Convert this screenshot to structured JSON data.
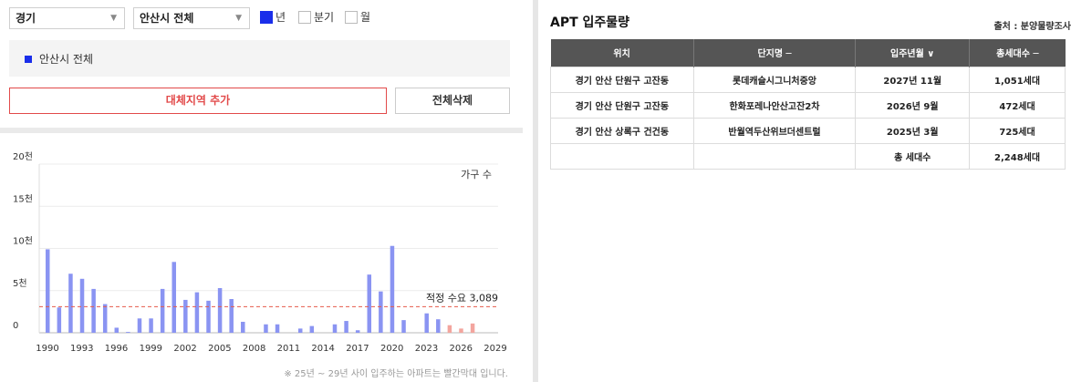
{
  "filters": {
    "province": "경기",
    "city": "안산시 전체",
    "periods": [
      {
        "label": "년",
        "checked": true
      },
      {
        "label": "분기",
        "checked": false
      },
      {
        "label": "월",
        "checked": false
      }
    ]
  },
  "region_tag": "안산시 전체",
  "buttons": {
    "add": "대체지역 추가",
    "clear": "전체삭제"
  },
  "note": "※ 25년 ~ 29년 사이 입주하는 아파트는 빨간막대 입니다.",
  "chart_data": {
    "type": "bar",
    "legend": "가구 수",
    "y_ticks": [
      "0",
      "5천",
      "10천",
      "15천",
      "20천"
    ],
    "ylim": [
      0,
      20000
    ],
    "x_ticks": [
      "1990",
      "1993",
      "1996",
      "1999",
      "2002",
      "2005",
      "2008",
      "2011",
      "2014",
      "2017",
      "2020",
      "2023",
      "2026",
      "2029"
    ],
    "x_range": [
      1990,
      2029
    ],
    "reference_line": {
      "label": "적정 수요 3,089",
      "value": 3089
    },
    "colors": {
      "past": "#8a94f2",
      "future": "#f3a59e",
      "ref": "#e65a4a"
    },
    "bars": [
      {
        "year": 1990,
        "value": 9900
      },
      {
        "year": 1991,
        "value": 3000
      },
      {
        "year": 1992,
        "value": 7000
      },
      {
        "year": 1993,
        "value": 6400
      },
      {
        "year": 1994,
        "value": 5200
      },
      {
        "year": 1995,
        "value": 3400
      },
      {
        "year": 1996,
        "value": 600
      },
      {
        "year": 1997,
        "value": 100
      },
      {
        "year": 1998,
        "value": 1700
      },
      {
        "year": 1999,
        "value": 1700
      },
      {
        "year": 2000,
        "value": 5200
      },
      {
        "year": 2001,
        "value": 8400
      },
      {
        "year": 2002,
        "value": 3900
      },
      {
        "year": 2003,
        "value": 4800
      },
      {
        "year": 2004,
        "value": 3800
      },
      {
        "year": 2005,
        "value": 5300
      },
      {
        "year": 2006,
        "value": 4000
      },
      {
        "year": 2007,
        "value": 1300
      },
      {
        "year": 2009,
        "value": 1000
      },
      {
        "year": 2010,
        "value": 1000
      },
      {
        "year": 2012,
        "value": 500
      },
      {
        "year": 2013,
        "value": 800
      },
      {
        "year": 2015,
        "value": 1000
      },
      {
        "year": 2016,
        "value": 1400
      },
      {
        "year": 2017,
        "value": 300
      },
      {
        "year": 2018,
        "value": 6900
      },
      {
        "year": 2019,
        "value": 4900
      },
      {
        "year": 2020,
        "value": 10300
      },
      {
        "year": 2021,
        "value": 1500
      },
      {
        "year": 2023,
        "value": 2300
      },
      {
        "year": 2024,
        "value": 1600
      },
      {
        "year": 2025,
        "value": 900,
        "future": true
      },
      {
        "year": 2026,
        "value": 500,
        "future": true
      },
      {
        "year": 2027,
        "value": 1100,
        "future": true
      }
    ]
  },
  "apt": {
    "title": "APT 입주물량",
    "source": "출처 : 분양물량조사",
    "headers": [
      "위치",
      "단지명 ─",
      "입주년월 ∨",
      "총세대수 ─"
    ],
    "rows": [
      [
        "경기 안산 단원구 고잔동",
        "롯데캐슬시그니처중앙",
        "2027년 11월",
        "1,051세대"
      ],
      [
        "경기 안산 단원구 고잔동",
        "한화포레나안산고잔2차",
        "2026년 9월",
        "472세대"
      ],
      [
        "경기 안산 상록구 건건동",
        "반월역두산위브더센트럴",
        "2025년 3월",
        "725세대"
      ]
    ],
    "total_label": "총 세대수",
    "total_value": "2,248세대"
  }
}
